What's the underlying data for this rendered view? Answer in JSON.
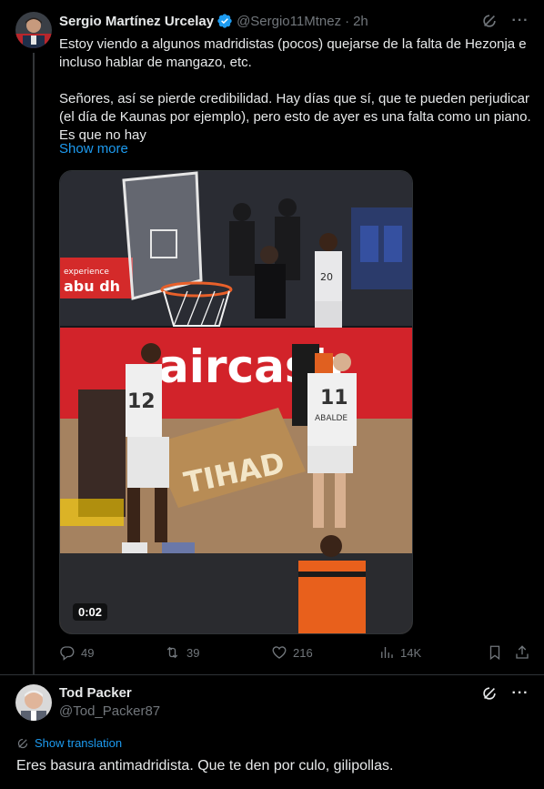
{
  "tweet1": {
    "author_name": "Sergio Martínez Urcelay",
    "handle": "@Sergio11Mtnez",
    "dot": "·",
    "time": "2h",
    "verified": true,
    "text_lines": [
      "Estoy viendo a algunos madridistas (pocos) quejarse de la falta de Hezonja e incluso hablar de mangazo, etc.",
      "Señores, así se pierde credibilidad. Hay días que sí, que te pueden perjudicar (el día de Kaunas por ejemplo), pero esto de ayer es una falta como un piano. Es que no hay"
    ],
    "show_more": "Show more",
    "media": {
      "duration": "0:02",
      "court_banner_text": "aircash",
      "floor_text": "TIHAD",
      "ad_board_text": "experience abu dh",
      "player1_number": "12",
      "player2_number": "11",
      "player2_name": "ABALDE",
      "player3_number": "20"
    },
    "actions": {
      "replies": "49",
      "retweets": "39",
      "likes": "216",
      "views": "14K"
    }
  },
  "tweet2": {
    "author_name": "Tod Packer",
    "handle": "@Tod_Packer87",
    "show_translation": "Show translation",
    "text": "Eres basura antimadridista. Que te den por culo, gilipollas."
  },
  "icons": [
    "grok-icon",
    "more-icon",
    "reply-icon",
    "retweet-icon",
    "like-icon",
    "views-icon",
    "bookmark-icon",
    "share-icon",
    "translate-icon"
  ],
  "colors": {
    "background": "#000000",
    "text": "#e7e9ea",
    "muted": "#71767b",
    "accent": "#1d9bf0",
    "border": "#2f3336"
  }
}
